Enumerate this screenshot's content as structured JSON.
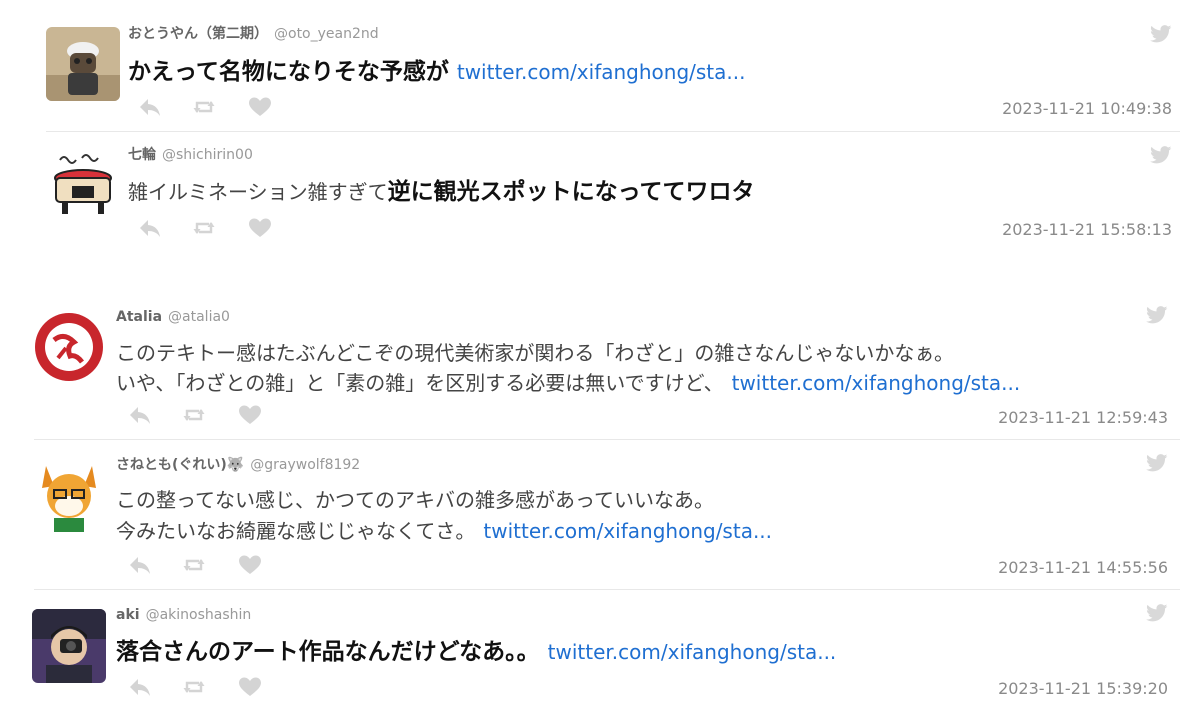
{
  "tweets": [
    {
      "name": "おとうやん（第二期）",
      "handle": "@oto_yean2nd",
      "text_bold": "かえって名物になりそな予感が",
      "link": "twitter.com/xifanghong/sta...",
      "timestamp": "2023-11-21 10:49:38"
    },
    {
      "name": "七輪",
      "handle": "@shichirin00",
      "text_normal": "雑イルミネーション雑すぎて",
      "text_bold": "逆に観光スポットになっててワロタ",
      "timestamp": "2023-11-21 15:58:13"
    },
    {
      "name": "Atalia",
      "handle": "@atalia0",
      "line1": "このテキトー感はたぶんどこぞの現代美術家が関わる「わざと」の雑さなんじゃないかなぁ。",
      "line2": "いや、「わざとの雑」と「素の雑」を区別する必要は無いですけど、",
      "link": "twitter.com/xifanghong/sta...",
      "timestamp": "2023-11-21 12:59:43"
    },
    {
      "name": "さねとも(ぐれい)🐺",
      "handle": "@graywolf8192",
      "line1": "この整ってない感じ、かつてのアキバの雑多感があっていいなあ。",
      "line2": "今みたいなお綺麗な感じじゃなくてさ。",
      "link": "twitter.com/xifanghong/sta...",
      "timestamp": "2023-11-21 14:55:56"
    },
    {
      "name": "aki",
      "handle": "@akinoshashin",
      "text_bold": "落合さんのアート作品なんだけどなあ。。",
      "link": "twitter.com/xifanghong/sta...",
      "timestamp": "2023-11-21 15:39:20"
    }
  ],
  "icons": {
    "reply": "reply-icon",
    "retweet": "retweet-icon",
    "like": "heart-icon",
    "brand": "twitter-bird-icon"
  },
  "colors": {
    "link": "#1f6fd1",
    "icon": "#d4d4d4",
    "timestamp": "#8a8a8a"
  }
}
